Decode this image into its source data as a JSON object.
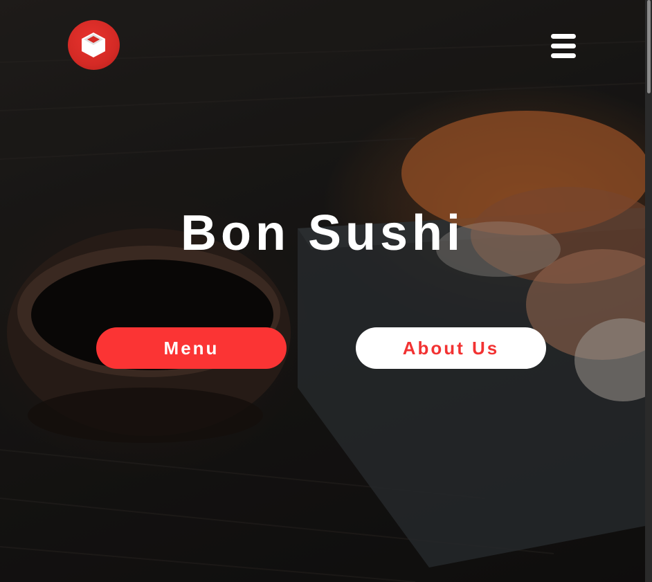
{
  "brand": {
    "logo_icon": "cube-icon",
    "accent_color": "#fb3434"
  },
  "header": {
    "menu_icon": "hamburger-menu-icon"
  },
  "hero": {
    "title": "Bon Sushi",
    "buttons": {
      "menu_label": "Menu",
      "about_label": "About Us"
    }
  }
}
